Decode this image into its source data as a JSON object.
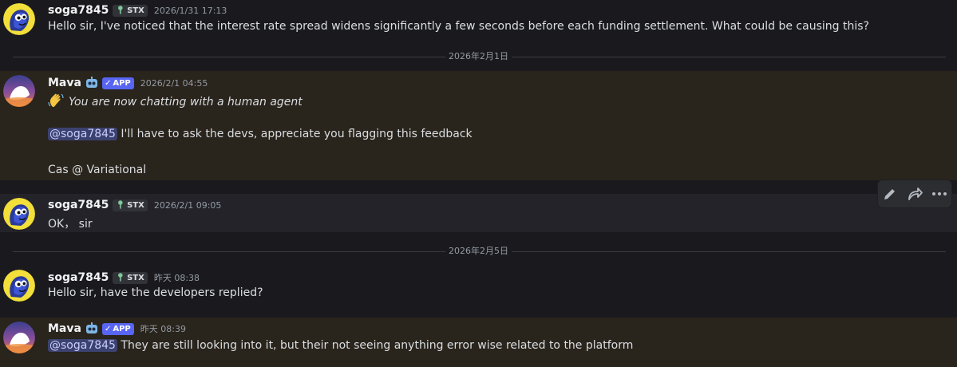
{
  "messages": [
    {
      "author": "soga7845",
      "tag": "STX",
      "timestamp": "2026/1/31 17:13",
      "text": "Hello sir, I've noticed that the interest rate spread widens significantly a few seconds before each funding settlement. What could be causing this?"
    },
    {
      "author": "Mava",
      "badge": "APP",
      "timestamp": "2026/2/1 04:55",
      "line1": "You are now chatting with a human agent",
      "mention": "@soga7845",
      "line2": " I'll have to ask the devs, appreciate you flagging this feedback",
      "line3": "Cas @ Variational"
    },
    {
      "author": "soga7845",
      "tag": "STX",
      "timestamp": "2026/2/1 09:05",
      "text": "OK， sir"
    },
    {
      "author": "soga7845",
      "tag": "STX",
      "timestamp": "昨天 08:38",
      "text": "Hello sir, have the developers replied?"
    },
    {
      "author": "Mava",
      "badge": "APP",
      "timestamp": "昨天 08:39",
      "mention": "@soga7845",
      "text": " They are still looking into it, but their not seeing anything error wise related to the platform"
    }
  ],
  "dividers": [
    "2026年2月1日",
    "2026年2月5日"
  ],
  "colors": {
    "background": "#1a1a1e",
    "highlight_row": "#29241c",
    "app_badge": "#5865f2",
    "mention_bg": "#3c4270"
  },
  "icons": {
    "toolbar": [
      "pencil-icon",
      "forward-icon",
      "more-icon"
    ],
    "emoji": "waving-hand-icon"
  }
}
